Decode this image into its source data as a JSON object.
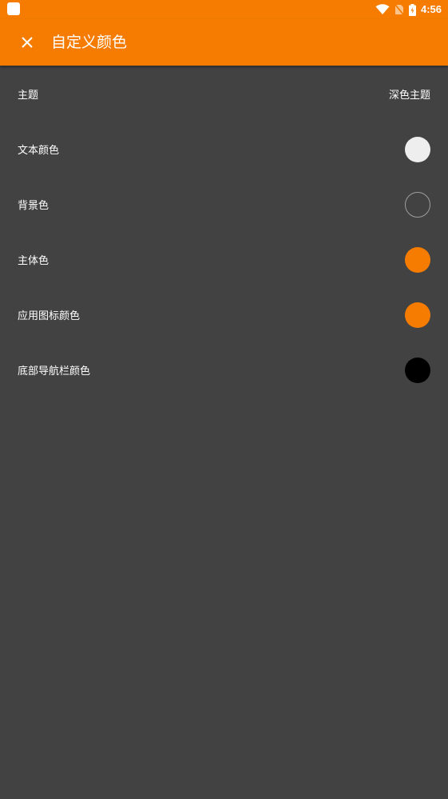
{
  "status_bar": {
    "time": "4:56",
    "icons": [
      "app-notification-icon",
      "wifi-icon",
      "no-sim-icon",
      "battery-charging-icon"
    ]
  },
  "app_bar": {
    "title": "自定义颜色",
    "close_icon": "close-icon"
  },
  "colors": {
    "accent": "#f57c00",
    "background": "#424242",
    "text": "#ffffff"
  },
  "settings": {
    "theme": {
      "label": "主题",
      "value": "深色主题"
    },
    "text_color": {
      "label": "文本颜色",
      "color": "#eeeeee"
    },
    "background_color": {
      "label": "背景色",
      "color": "#424242"
    },
    "primary_color": {
      "label": "主体色",
      "color": "#f57c00"
    },
    "app_icon_color": {
      "label": "应用图标颜色",
      "color": "#f57c00"
    },
    "nav_bar_color": {
      "label": "底部导航栏颜色",
      "color": "#000000"
    }
  }
}
